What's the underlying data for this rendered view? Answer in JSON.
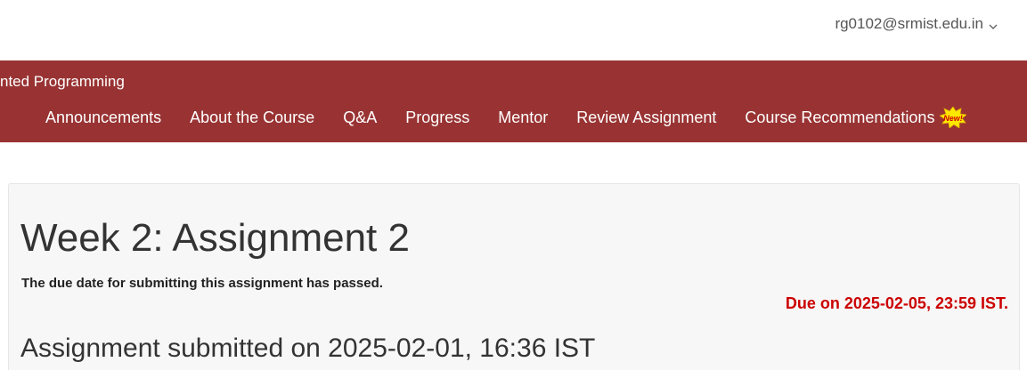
{
  "header": {
    "user_email": "rg0102@srmist.edu.in"
  },
  "course": {
    "title_visible": "nted Programming"
  },
  "nav": {
    "items": [
      {
        "label": "Announcements"
      },
      {
        "label": "About the Course"
      },
      {
        "label": "Q&A"
      },
      {
        "label": "Progress"
      },
      {
        "label": "Mentor"
      },
      {
        "label": "Review Assignment"
      },
      {
        "label": "Course Recommendations"
      }
    ],
    "new_badge": "New!"
  },
  "assignment": {
    "title": "Week 2: Assignment 2",
    "due_passed_text": "The due date for submitting this assignment has passed.",
    "due_on": "Due on 2025-02-05, 23:59 IST.",
    "submitted_text": "Assignment submitted on 2025-02-01, 16:36 IST"
  },
  "colors": {
    "nav_background": "#993333",
    "due_red": "#cc0000",
    "badge_yellow": "#ffe800"
  }
}
